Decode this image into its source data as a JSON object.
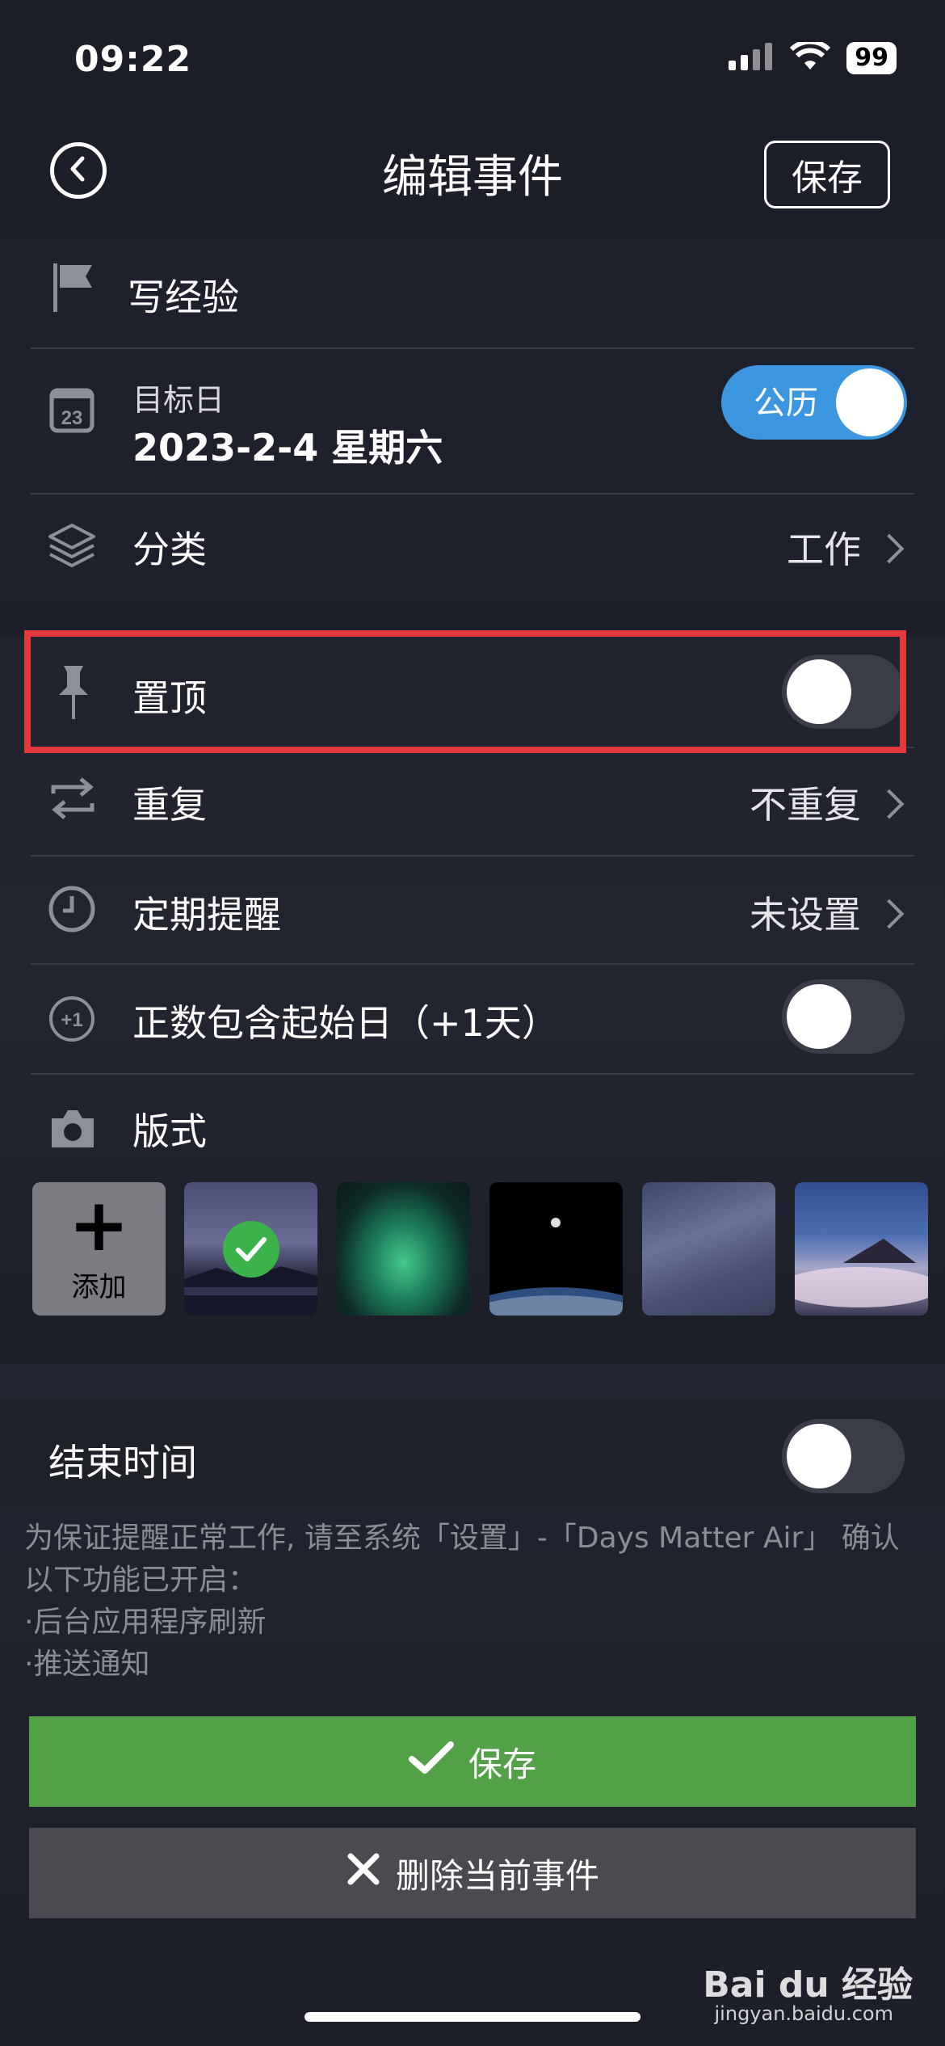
{
  "status": {
    "time": "09:22",
    "battery": "99"
  },
  "nav": {
    "title": "编辑事件",
    "save_label": "保存"
  },
  "event": {
    "name": "写经验"
  },
  "target_date": {
    "label": "目标日",
    "value": "2023-2-4 星期六",
    "calendar_type": "公历",
    "calendar_icon_text": "23"
  },
  "category": {
    "label": "分类",
    "value": "工作"
  },
  "pin": {
    "label": "置顶",
    "on": false
  },
  "repeat": {
    "label": "重复",
    "value": "不重复"
  },
  "reminder": {
    "label": "定期提醒",
    "value": "未设置"
  },
  "include_start": {
    "label": "正数包含起始日（+1天）",
    "badge": "+1",
    "on": false
  },
  "style": {
    "label": "版式",
    "add_label": "添加",
    "thumbnails": [
      "mountain-lake-night",
      "aurora",
      "astronaut-earth",
      "milky-way",
      "volcano-sunrise"
    ],
    "selected_index": 0
  },
  "end_time": {
    "label": "结束时间",
    "on": false
  },
  "notice": {
    "line1": "为保证提醒正常工作, 请至系统「设置」-「Days Matter Air」 确认以下功能已开启：",
    "line2": "·后台应用程序刷新",
    "line3": "·推送通知"
  },
  "buttons": {
    "save": "保存",
    "delete": "删除当前事件"
  },
  "watermark": {
    "brand": "Bai du 经验",
    "url": "jingyan.baidu.com"
  },
  "colors": {
    "accent_blue": "#3d97e0",
    "save_green": "#52a146",
    "highlight_red": "#e0393e"
  }
}
